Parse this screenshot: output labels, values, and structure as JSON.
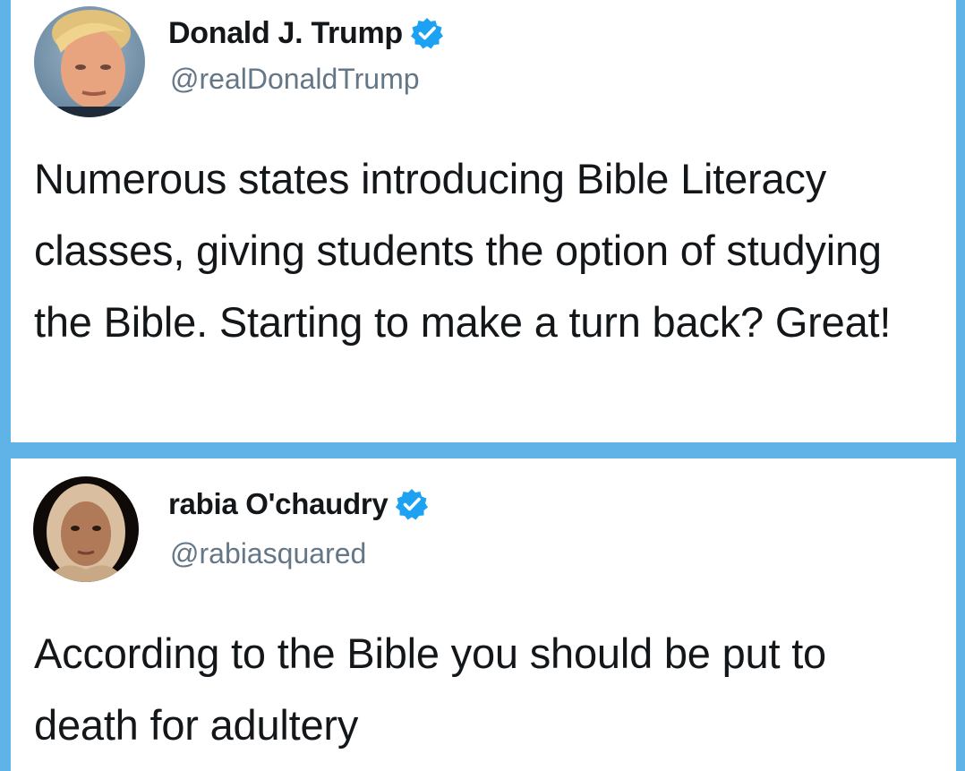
{
  "tweets": [
    {
      "display_name": "Donald J. Trump",
      "handle": "@realDonaldTrump",
      "verified_icon": "verified-badge-icon",
      "text": "Numerous states introducing Bible Literacy classes, giving students the option of studying the Bible. Starting to make a turn back? Great!"
    },
    {
      "display_name": "rabia O'chaudry",
      "handle": "@rabiasquared",
      "verified_icon": "verified-badge-icon",
      "text": "According to the Bible you should be put to death for adultery"
    }
  ],
  "colors": {
    "background": "#5fb3e6",
    "verified": "#1da1f2",
    "text": "#14171a",
    "handle": "#657786"
  }
}
